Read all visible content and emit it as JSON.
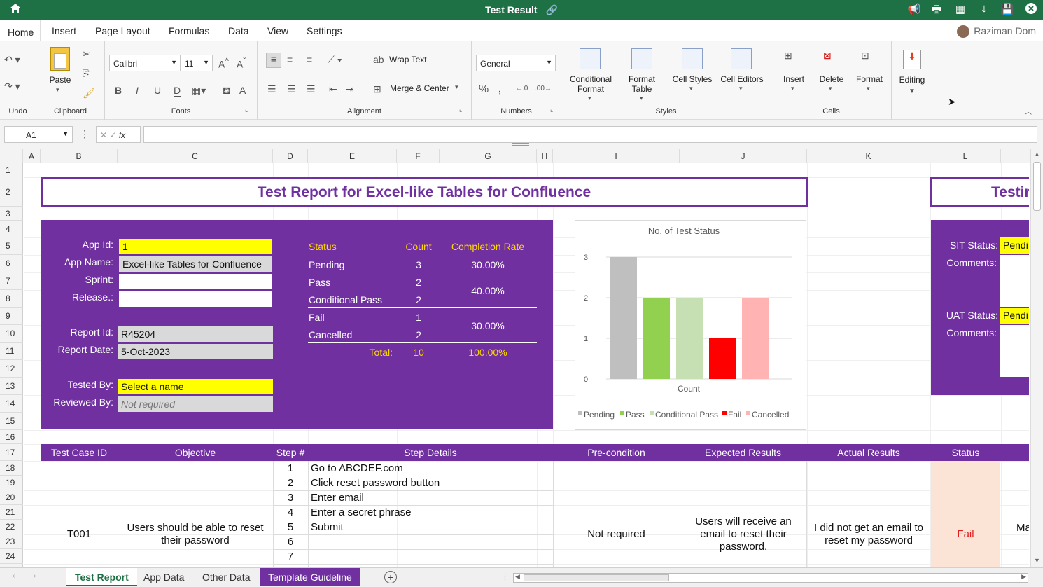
{
  "window": {
    "title": "Test Result"
  },
  "menu": {
    "home": "Home",
    "insert": "Insert",
    "page_layout": "Page Layout",
    "formulas": "Formulas",
    "data": "Data",
    "view": "View",
    "settings": "Settings",
    "user": "Raziman Dom"
  },
  "ribbon": {
    "undo_group": "Undo",
    "clipboard_group": "Clipboard",
    "paste": "Paste",
    "font_name": "Calibri",
    "font_size": "11",
    "fonts_group": "Fonts",
    "wrap_text": "Wrap Text",
    "merge_center": "Merge & Center",
    "alignment_group": "Alignment",
    "number_format": "General",
    "numbers_group": "Numbers",
    "conditional_format": "Conditional\nFormat",
    "format_table": "Format\nTable",
    "cell_styles": "Cell Styles",
    "cell_editors": "Cell Editors",
    "styles_group": "Styles",
    "insert": "Insert",
    "delete": "Delete",
    "format": "Format",
    "cells_group": "Cells",
    "editing": "Editing"
  },
  "formula_bar": {
    "cell_ref": "A1",
    "fx": "fx",
    "value": ""
  },
  "columns": [
    "A",
    "B",
    "C",
    "D",
    "E",
    "F",
    "G",
    "H",
    "I",
    "J",
    "K",
    "L"
  ],
  "rows": [
    "1",
    "2",
    "3",
    "4",
    "5",
    "6",
    "7",
    "8",
    "9",
    "10",
    "11",
    "12",
    "13",
    "14",
    "15",
    "16",
    "17",
    "18",
    "19",
    "20",
    "21",
    "22",
    "23",
    "24"
  ],
  "report": {
    "title": "Test Report for Excel-like Tables for Confluence",
    "side_title": "Testin",
    "labels": {
      "app_id": "App Id:",
      "app_name": "App Name:",
      "sprint": "Sprint:",
      "release": "Release.:",
      "report_id": "Report Id:",
      "report_date": "Report Date:",
      "tested_by": "Tested By:",
      "reviewed_by": "Reviewed By:"
    },
    "values": {
      "app_id": "1",
      "app_name": "Excel-like Tables for Confluence",
      "sprint": "",
      "release": "",
      "report_id": "R45204",
      "report_date": "5-Oct-2023",
      "tested_by": "Select a name",
      "reviewed_by": "Not required"
    },
    "status_table": {
      "headers": [
        "Status",
        "Count",
        "Completion Rate"
      ],
      "rows": [
        {
          "status": "Pending",
          "count": "3",
          "rate": "30.00%"
        },
        {
          "status": "Pass",
          "count": "2",
          "rate": "40.00%"
        },
        {
          "status": "Conditional Pass",
          "count": "2",
          "rate": ""
        },
        {
          "status": "Fail",
          "count": "1",
          "rate": "30.00%"
        },
        {
          "status": "Cancelled",
          "count": "2",
          "rate": ""
        }
      ],
      "total_label": "Total:",
      "total_count": "10",
      "total_rate": "100.00%"
    },
    "right_panel": {
      "sit_status": "SIT Status:",
      "sit_value": "Pendi",
      "comments1": "Comments:",
      "uat_status": "UAT Status:",
      "uat_value": "Pendi",
      "comments2": "Comments:"
    }
  },
  "chart_data": {
    "type": "bar",
    "title": "No. of Test Status",
    "xlabel": "Count",
    "categories": [
      "Count"
    ],
    "series": [
      {
        "name": "Pending",
        "values": [
          3
        ],
        "color": "#bfbfbf"
      },
      {
        "name": "Pass",
        "values": [
          2
        ],
        "color": "#92d050"
      },
      {
        "name": "Conditional Pass",
        "values": [
          2
        ],
        "color": "#c6e0b4"
      },
      {
        "name": "Fail",
        "values": [
          1
        ],
        "color": "#ff0000"
      },
      {
        "name": "Cancelled",
        "values": [
          2
        ],
        "color": "#ffb3b3"
      }
    ],
    "ylim": [
      0,
      3
    ],
    "yticks": [
      "0",
      "1",
      "2",
      "3"
    ],
    "legend": "bottom"
  },
  "test_table": {
    "headers": [
      "Test Case ID",
      "Objective",
      "Step #",
      "Step Details",
      "Pre-condition",
      "Expected Results",
      "Actual Results",
      "Status"
    ],
    "case_id": "T001",
    "objective": "Users should be able to reset their password",
    "steps": [
      {
        "n": "1",
        "d": "Go to ABCDEF.com"
      },
      {
        "n": "2",
        "d": "Click reset password button"
      },
      {
        "n": "3",
        "d": "Enter email"
      },
      {
        "n": "4",
        "d": "Enter a secret phrase"
      },
      {
        "n": "5",
        "d": "Submit"
      },
      {
        "n": "6",
        "d": ""
      },
      {
        "n": "7",
        "d": ""
      }
    ],
    "precondition": "Not required",
    "expected": "Users will receive an email to reset their password.",
    "actual": "I did not get an email to reset my password",
    "status": "Fail",
    "overflow": "Ma"
  },
  "tabs": [
    "Test Report",
    "App Data",
    "Other Data",
    "Template Guideline"
  ],
  "colors": {
    "brand": "#1e7145",
    "purple": "#7030a0",
    "yellow": "#ffff00",
    "gold": "#ffd700"
  }
}
